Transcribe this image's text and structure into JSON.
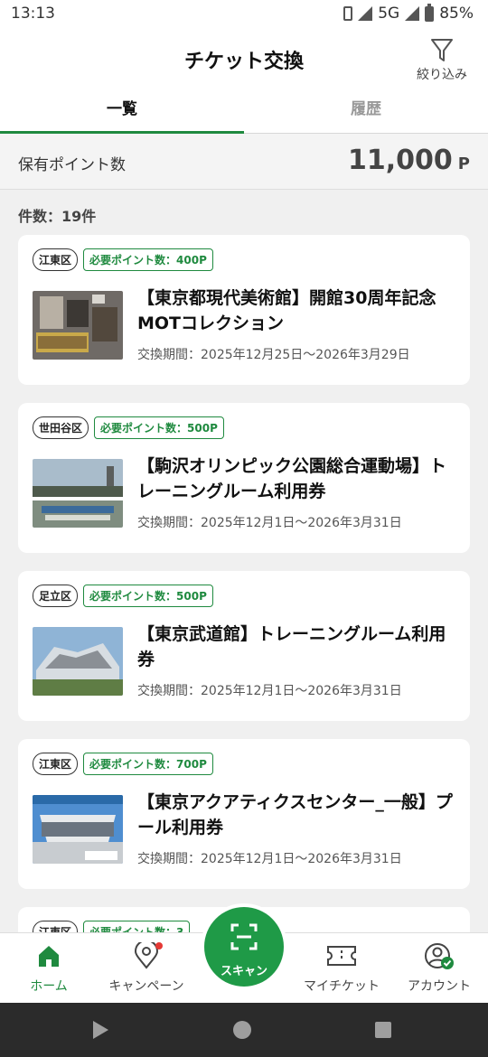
{
  "status": {
    "time": "13:13",
    "network": "5G",
    "battery": "85%"
  },
  "header": {
    "title": "チケット交換",
    "filter_label": "絞り込み"
  },
  "tabs": [
    {
      "label": "一覧",
      "active": true
    },
    {
      "label": "履歴",
      "active": false
    }
  ],
  "points": {
    "label": "保有ポイント数",
    "value": "11,000",
    "unit": "P"
  },
  "count_label": "件数：19件",
  "cards": [
    {
      "area": "江東区",
      "points": "必要ポイント数：400P",
      "title": "【東京都現代美術館】開館30周年記念MOTコレクション",
      "period": "交換期間：2025年12月25日〜2026年3月29日"
    },
    {
      "area": "世田谷区",
      "points": "必要ポイント数：500P",
      "title": "【駒沢オリンピック公園総合運動場】トレーニングルーム利用券",
      "period": "交換期間：2025年12月1日〜2026年3月31日"
    },
    {
      "area": "足立区",
      "points": "必要ポイント数：500P",
      "title": "【東京武道館】トレーニングルーム利用券",
      "period": "交換期間：2025年12月1日〜2026年3月31日"
    },
    {
      "area": "江東区",
      "points": "必要ポイント数：700P",
      "title": "【東京アクアティクスセンター_一般】プール利用券",
      "period": "交換期間：2025年12月1日〜2026年3月31日"
    },
    {
      "area": "江東区",
      "points": "必要ポイント数：3",
      "title": "",
      "period": ""
    }
  ],
  "nav": {
    "home": "ホーム",
    "campaign": "キャンペーン",
    "scan": "スキャン",
    "my_ticket": "マイチケット",
    "account": "アカウント"
  },
  "colors": {
    "accent": "#1f8a3f",
    "scan": "#1f9a47",
    "badge": "#e53935"
  }
}
